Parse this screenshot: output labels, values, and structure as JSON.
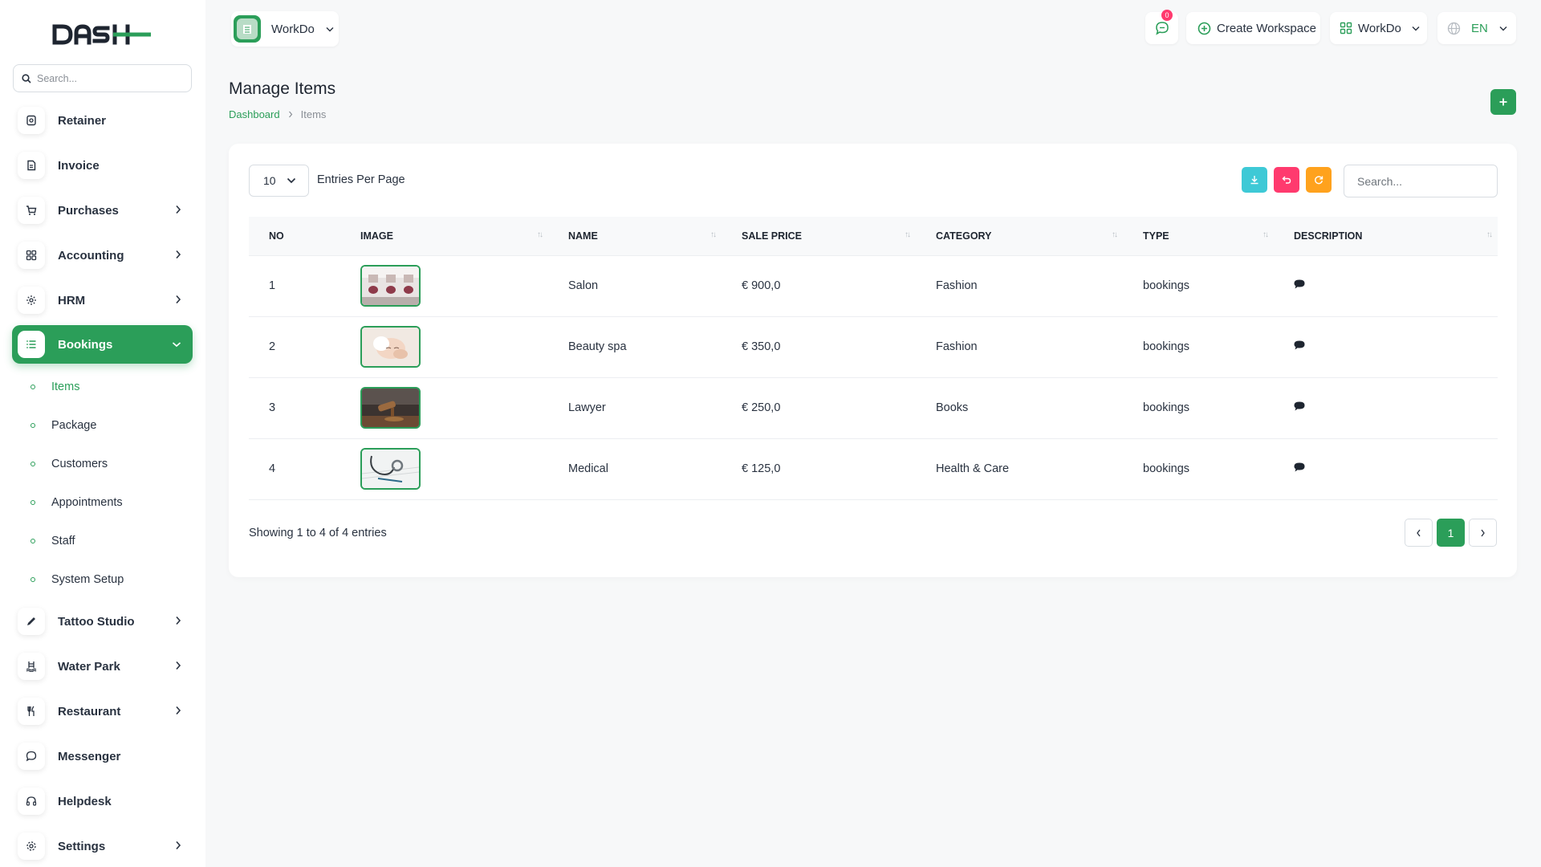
{
  "brand": {
    "logo_text": "DASH"
  },
  "sidebar": {
    "search_placeholder": "Search...",
    "items": [
      {
        "label": "Retainer"
      },
      {
        "label": "Invoice"
      },
      {
        "label": "Purchases"
      },
      {
        "label": "Accounting"
      },
      {
        "label": "HRM"
      },
      {
        "label": "Bookings"
      },
      {
        "label": "Tattoo Studio"
      },
      {
        "label": "Water Park"
      },
      {
        "label": "Restaurant"
      },
      {
        "label": "Messenger"
      },
      {
        "label": "Helpdesk"
      },
      {
        "label": "Settings"
      }
    ],
    "subitems": [
      {
        "label": "Items"
      },
      {
        "label": "Package"
      },
      {
        "label": "Customers"
      },
      {
        "label": "Appointments"
      },
      {
        "label": "Staff"
      },
      {
        "label": "System Setup"
      }
    ]
  },
  "header": {
    "workspace_name": "WorkDo",
    "notification_count": "0",
    "create_workspace": "Create Workspace",
    "user_workspace": "WorkDo",
    "language": "EN"
  },
  "page": {
    "title": "Manage Items",
    "breadcrumb_home": "Dashboard",
    "breadcrumb_current": "Items"
  },
  "table": {
    "per_page": "10",
    "per_page_label": "Entries Per Page",
    "search_placeholder": "Search...",
    "columns": [
      "NO",
      "IMAGE",
      "NAME",
      "SALE PRICE",
      "CATEGORY",
      "TYPE",
      "DESCRIPTION"
    ],
    "rows": [
      {
        "no": "1",
        "name": "Salon",
        "price": "€ 900,0",
        "category": "Fashion",
        "type": "bookings"
      },
      {
        "no": "2",
        "name": "Beauty spa",
        "price": "€ 350,0",
        "category": "Fashion",
        "type": "bookings"
      },
      {
        "no": "3",
        "name": "Lawyer",
        "price": "€ 250,0",
        "category": "Books",
        "type": "bookings"
      },
      {
        "no": "4",
        "name": "Medical",
        "price": "€ 125,0",
        "category": "Health & Care",
        "type": "bookings"
      }
    ],
    "showing": "Showing 1 to 4 of 4 entries",
    "current_page": "1"
  },
  "colors": {
    "accent": "#2b9e59",
    "export": "#3ec9d6",
    "undo": "#ff3a6e",
    "refresh": "#ffa21d"
  }
}
